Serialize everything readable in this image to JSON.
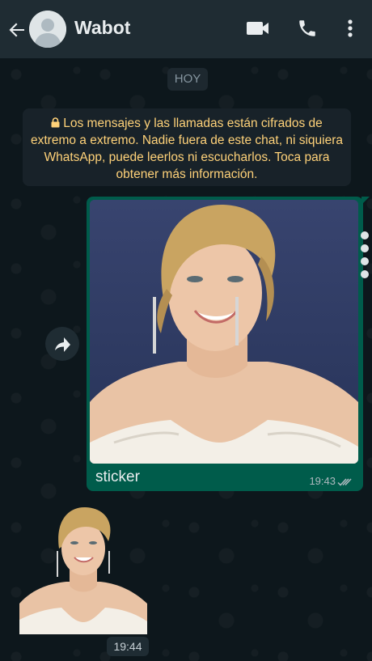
{
  "header": {
    "contact_name": "Wabot",
    "icons": [
      "back-arrow-icon",
      "avatar-icon",
      "video-call-icon",
      "phone-icon",
      "more-vert-icon"
    ]
  },
  "chat": {
    "date_label": "HOY",
    "encryption_notice": "Los mensajes y las llamadas están cifrados de extremo a extremo. Nadie fuera de este chat, ni siquiera WhatsApp, puede leerlos ni escucharlos. Toca para obtener más información.",
    "outgoing_message": {
      "caption": "sticker",
      "time": "19:43",
      "status": "read"
    },
    "incoming_sticker": {
      "time": "19:44"
    }
  },
  "colors": {
    "header_bg": "#1f2c33",
    "outgoing_bubble": "#005c4b",
    "notice_text": "#ffd279",
    "chat_bg": "#0d171c"
  }
}
